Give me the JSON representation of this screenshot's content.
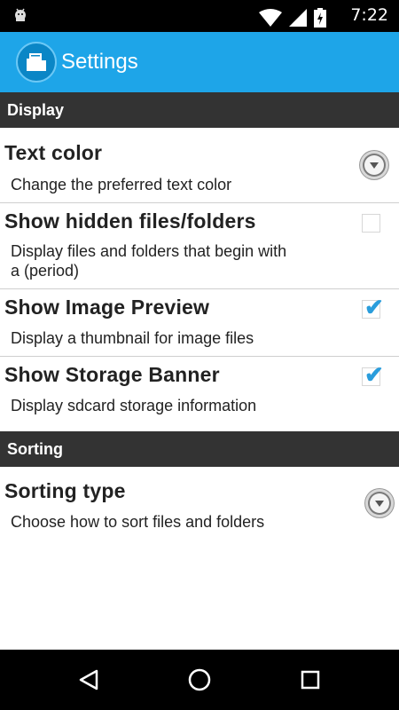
{
  "status_bar": {
    "time": "7:22"
  },
  "app_bar": {
    "title": "Settings"
  },
  "sections": {
    "display": {
      "header": "Display"
    },
    "sorting": {
      "header": "Sorting"
    }
  },
  "prefs": {
    "text_color": {
      "title": "Text color",
      "summary": "Change the preferred text color"
    },
    "hidden_files": {
      "title": "Show hidden files/folders",
      "summary": "Display files and folders that begin with a (period)",
      "checked": false
    },
    "image_preview": {
      "title": "Show Image Preview",
      "summary": "Display a thumbnail for image files",
      "checked": true
    },
    "storage_banner": {
      "title": "Show Storage Banner",
      "summary": "Display sdcard storage information",
      "checked": true
    },
    "sorting_type": {
      "title": "Sorting type",
      "summary": "Choose how to sort files and folders"
    }
  },
  "nav_bar": {
    "back_icon": "back-triangle",
    "home_icon": "home-circle",
    "recents_icon": "recents-square"
  },
  "colors": {
    "app_bar": "#1ea5e8",
    "section_header": "#333333",
    "checkmark": "#2a9ddc"
  }
}
